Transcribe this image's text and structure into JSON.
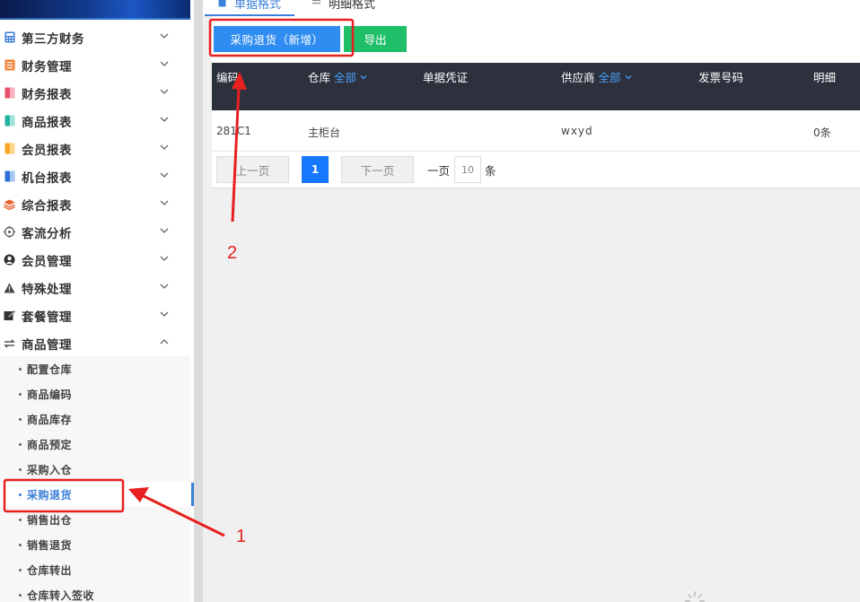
{
  "sidebar": {
    "items": [
      {
        "label": "第三方财务",
        "icon": "calculator-icon",
        "color": "#3b7ddd",
        "expanded": false
      },
      {
        "label": "财务管理",
        "icon": "ledger-icon",
        "color": "#f07c2a",
        "expanded": false
      },
      {
        "label": "财务报表",
        "icon": "finance-report-icon",
        "color": "#e8506b",
        "expanded": false
      },
      {
        "label": "商品报表",
        "icon": "goods-report-icon",
        "color": "#22b3a0",
        "expanded": false
      },
      {
        "label": "会员报表",
        "icon": "member-report-icon",
        "color": "#f5a623",
        "expanded": false
      },
      {
        "label": "机台报表",
        "icon": "machine-report-icon",
        "color": "#2d6fd9",
        "expanded": false
      },
      {
        "label": "综合报表",
        "icon": "layers-icon",
        "color": "#e8602c",
        "expanded": false
      },
      {
        "label": "客流分析",
        "icon": "target-icon",
        "color": "#555555",
        "expanded": false
      },
      {
        "label": "会员管理",
        "icon": "user-icon",
        "color": "#333333",
        "expanded": false
      },
      {
        "label": "特殊处理",
        "icon": "warning-icon",
        "color": "#444444",
        "expanded": false
      },
      {
        "label": "套餐管理",
        "icon": "edit-icon",
        "color": "#333333",
        "expanded": false
      },
      {
        "label": "商品管理",
        "icon": "swap-icon",
        "color": "#333333",
        "expanded": true
      }
    ],
    "subitems": [
      {
        "label": "配置仓库",
        "active": false
      },
      {
        "label": "商品编码",
        "active": false
      },
      {
        "label": "商品库存",
        "active": false
      },
      {
        "label": "商品预定",
        "active": false
      },
      {
        "label": "采购入仓",
        "active": false
      },
      {
        "label": "采购退货",
        "active": true
      },
      {
        "label": "销售出仓",
        "active": false
      },
      {
        "label": "销售退货",
        "active": false
      },
      {
        "label": "仓库转出",
        "active": false
      },
      {
        "label": "仓库转入签收",
        "active": false
      }
    ]
  },
  "tabs": {
    "doc_format": "单据格式",
    "detail_format": "明细格式"
  },
  "toolbar": {
    "return_new_label": "采购退货（新增）",
    "export_label": "导出"
  },
  "table": {
    "headers": {
      "code": "编码",
      "warehouse": "仓库",
      "warehouse_filter": "全部",
      "voucher": "单据凭证",
      "supplier": "供应商",
      "supplier_filter": "全部",
      "invoice": "发票号码",
      "detail": "明细"
    },
    "rows": [
      {
        "code": "281C1",
        "warehouse": "主柜台",
        "voucher": "",
        "supplier": "wxyd",
        "invoice": "",
        "detail": "0条"
      }
    ]
  },
  "pagination": {
    "prev_label": "上一页",
    "current_page": "1",
    "next_label": "下一页",
    "per_page_label": "一页",
    "per_page_value": "10",
    "per_page_unit": "条"
  },
  "annotations": {
    "marker_1": "1",
    "marker_2": "2",
    "color": "#e82020"
  },
  "colors": {
    "accent": "#2f8cf0",
    "export_green": "#1fbf6a",
    "table_header_bg": "#2c313d",
    "filter_blue": "#4a9cf5",
    "active_blue": "#3a7fd8"
  }
}
